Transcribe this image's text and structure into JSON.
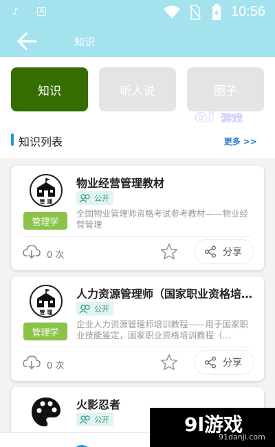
{
  "status_bar": {
    "time": "10:56",
    "icons": [
      "tiktok-icon",
      "a-app-icon",
      "wifi-icon",
      "no-sim-icon",
      "battery-charging-icon"
    ]
  },
  "header": {
    "title": "知识",
    "back_icon": "back-arrow-icon",
    "background_color": "#a4e2ee"
  },
  "tabs": [
    {
      "label": "知识",
      "active": true
    },
    {
      "label": "听人说",
      "active": false
    },
    {
      "label": "圈子",
      "active": false
    }
  ],
  "section": {
    "title": "知识列表",
    "more_label": "更多 >>"
  },
  "items": [
    {
      "title": "物业经营管理教材",
      "visibility": "公开",
      "category": "管理学",
      "description": "全国物业管理师资格考试参考教材——物业经营管理",
      "download_count": "0 次",
      "share_label": "分享",
      "avatar_icon": "school-icon"
    },
    {
      "title": "人力资源管理师（国家职业资格培训…",
      "visibility": "公开",
      "category": "管理学",
      "description": "企业人力资源管理师培训教程——用于国家职业技能鉴定，国家职业资格培训教程（…",
      "download_count": "0 次",
      "share_label": "分享",
      "avatar_icon": "school-icon"
    },
    {
      "title": "火影忍者",
      "visibility": "公开",
      "avatar_icon": "palette-icon"
    }
  ],
  "avatar_caption": "管 理",
  "watermark": {
    "brand": "9l游戏",
    "site": "91danji.com"
  },
  "colors": {
    "accent_active_tab": "#366d00",
    "category_badge": "#8bc34a",
    "link_blue": "#2b7fd0"
  }
}
